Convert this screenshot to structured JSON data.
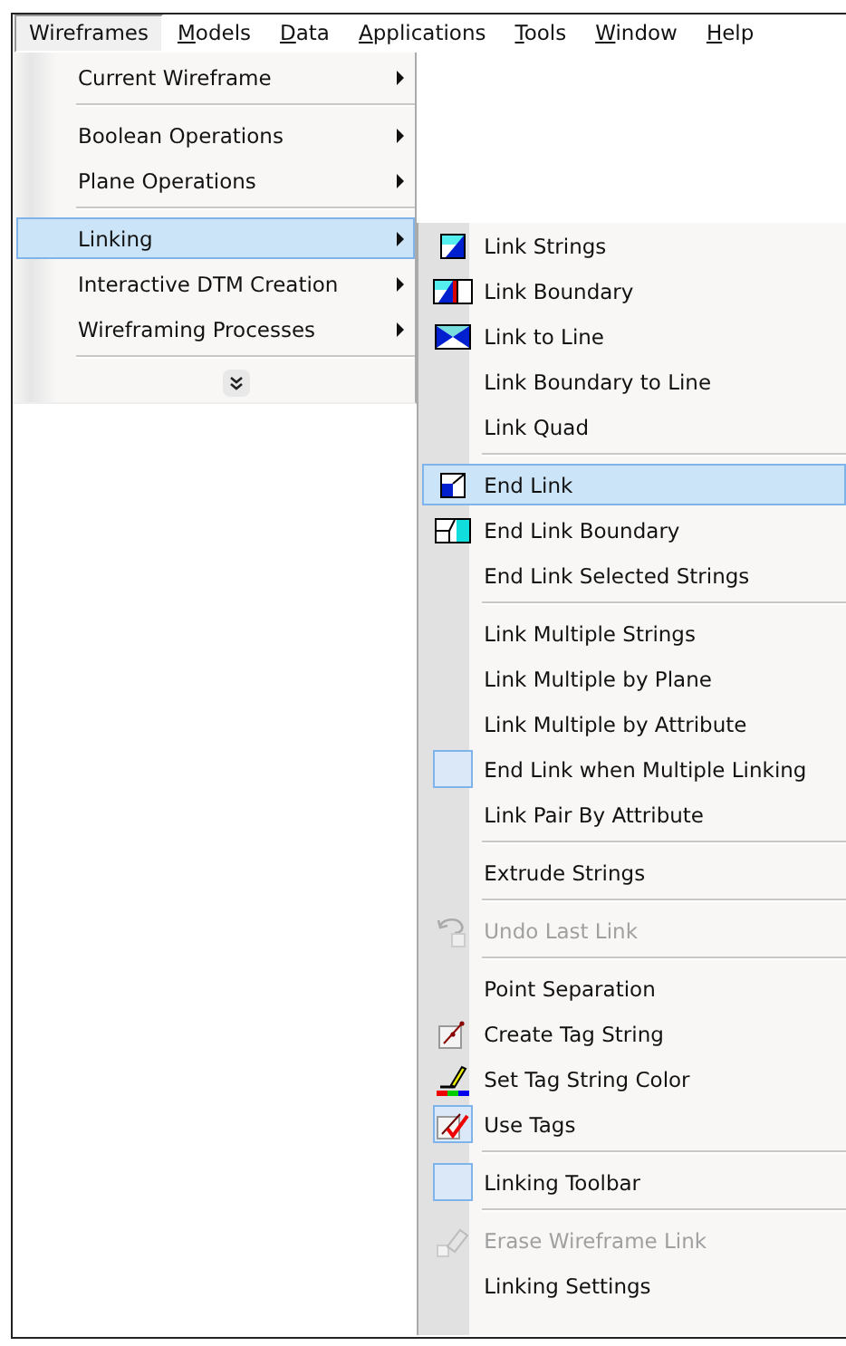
{
  "menu_bar": [
    {
      "label": "Wireframes",
      "open": true,
      "mnemonic": false
    },
    {
      "label": "Models",
      "open": false,
      "mnemonic": true
    },
    {
      "label": "Data",
      "open": false,
      "mnemonic": true
    },
    {
      "label": "Applications",
      "open": false,
      "mnemonic": true
    },
    {
      "label": "Tools",
      "open": false,
      "mnemonic": true
    },
    {
      "label": "Window",
      "open": false,
      "mnemonic": true
    },
    {
      "label": "Help",
      "open": false,
      "mnemonic": true
    }
  ],
  "wireframes_menu": [
    {
      "kind": "item",
      "label": "Current Wireframe",
      "selected": false
    },
    {
      "kind": "separator"
    },
    {
      "kind": "item",
      "label": "Boolean Operations",
      "selected": false
    },
    {
      "kind": "item",
      "label": "Plane Operations",
      "selected": false
    },
    {
      "kind": "separator"
    },
    {
      "kind": "item",
      "label": "Linking",
      "selected": true
    },
    {
      "kind": "item",
      "label": "Interactive DTM Creation",
      "selected": false
    },
    {
      "kind": "item",
      "label": "Wireframing Processes",
      "selected": false
    },
    {
      "kind": "separator"
    },
    {
      "kind": "more"
    }
  ],
  "linking_submenu": [
    {
      "kind": "item",
      "label": "Link Strings",
      "selected": false,
      "checked": false,
      "disabled": false
    },
    {
      "kind": "item",
      "label": "Link Boundary",
      "selected": false,
      "checked": false,
      "disabled": false
    },
    {
      "kind": "item",
      "label": "Link to Line",
      "selected": false,
      "checked": false,
      "disabled": false
    },
    {
      "kind": "item",
      "label": "Link Boundary to Line",
      "selected": false,
      "checked": false,
      "disabled": false
    },
    {
      "kind": "item",
      "label": "Link Quad",
      "selected": false,
      "checked": false,
      "disabled": false
    },
    {
      "kind": "separator"
    },
    {
      "kind": "item",
      "label": "End Link",
      "selected": true,
      "checked": false,
      "disabled": false
    },
    {
      "kind": "item",
      "label": "End Link Boundary",
      "selected": false,
      "checked": false,
      "disabled": false
    },
    {
      "kind": "item",
      "label": "End Link Selected Strings",
      "selected": false,
      "checked": false,
      "disabled": false
    },
    {
      "kind": "separator"
    },
    {
      "kind": "item",
      "label": "Link Multiple Strings",
      "selected": false,
      "checked": false,
      "disabled": false
    },
    {
      "kind": "item",
      "label": "Link Multiple by Plane",
      "selected": false,
      "checked": false,
      "disabled": false
    },
    {
      "kind": "item",
      "label": "Link Multiple by Attribute",
      "selected": false,
      "checked": false,
      "disabled": false
    },
    {
      "kind": "item",
      "label": "End Link when Multiple Linking",
      "selected": false,
      "checked": true,
      "disabled": false
    },
    {
      "kind": "item",
      "label": "Link Pair By Attribute",
      "selected": false,
      "checked": false,
      "disabled": false
    },
    {
      "kind": "separator"
    },
    {
      "kind": "item",
      "label": "Extrude Strings",
      "selected": false,
      "checked": false,
      "disabled": false
    },
    {
      "kind": "separator"
    },
    {
      "kind": "item",
      "label": "Undo Last Link",
      "selected": false,
      "checked": false,
      "disabled": true
    },
    {
      "kind": "separator"
    },
    {
      "kind": "item",
      "label": "Point Separation",
      "selected": false,
      "checked": false,
      "disabled": false
    },
    {
      "kind": "item",
      "label": "Create Tag String",
      "selected": false,
      "checked": false,
      "disabled": false
    },
    {
      "kind": "item",
      "label": "Set Tag String Color",
      "selected": false,
      "checked": false,
      "disabled": false
    },
    {
      "kind": "item",
      "label": "Use Tags",
      "selected": false,
      "checked": true,
      "disabled": false
    },
    {
      "kind": "separator"
    },
    {
      "kind": "item",
      "label": "Linking Toolbar",
      "selected": false,
      "checked": true,
      "disabled": false
    },
    {
      "kind": "separator"
    },
    {
      "kind": "item",
      "label": "Erase Wireframe Link",
      "selected": false,
      "checked": false,
      "disabled": true
    },
    {
      "kind": "item",
      "label": "Linking Settings",
      "selected": false,
      "checked": false,
      "disabled": false
    }
  ]
}
